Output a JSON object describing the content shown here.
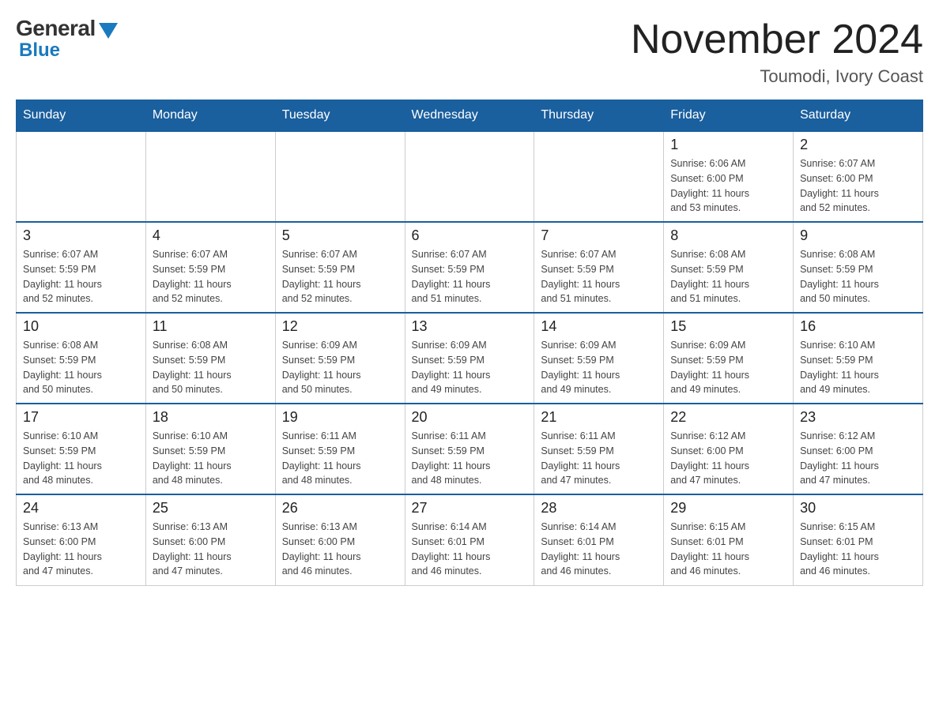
{
  "logo": {
    "general": "General",
    "blue": "Blue"
  },
  "title": "November 2024",
  "location": "Toumodi, Ivory Coast",
  "weekdays": [
    "Sunday",
    "Monday",
    "Tuesday",
    "Wednesday",
    "Thursday",
    "Friday",
    "Saturday"
  ],
  "weeks": [
    [
      {
        "day": "",
        "info": ""
      },
      {
        "day": "",
        "info": ""
      },
      {
        "day": "",
        "info": ""
      },
      {
        "day": "",
        "info": ""
      },
      {
        "day": "",
        "info": ""
      },
      {
        "day": "1",
        "info": "Sunrise: 6:06 AM\nSunset: 6:00 PM\nDaylight: 11 hours\nand 53 minutes."
      },
      {
        "day": "2",
        "info": "Sunrise: 6:07 AM\nSunset: 6:00 PM\nDaylight: 11 hours\nand 52 minutes."
      }
    ],
    [
      {
        "day": "3",
        "info": "Sunrise: 6:07 AM\nSunset: 5:59 PM\nDaylight: 11 hours\nand 52 minutes."
      },
      {
        "day": "4",
        "info": "Sunrise: 6:07 AM\nSunset: 5:59 PM\nDaylight: 11 hours\nand 52 minutes."
      },
      {
        "day": "5",
        "info": "Sunrise: 6:07 AM\nSunset: 5:59 PM\nDaylight: 11 hours\nand 52 minutes."
      },
      {
        "day": "6",
        "info": "Sunrise: 6:07 AM\nSunset: 5:59 PM\nDaylight: 11 hours\nand 51 minutes."
      },
      {
        "day": "7",
        "info": "Sunrise: 6:07 AM\nSunset: 5:59 PM\nDaylight: 11 hours\nand 51 minutes."
      },
      {
        "day": "8",
        "info": "Sunrise: 6:08 AM\nSunset: 5:59 PM\nDaylight: 11 hours\nand 51 minutes."
      },
      {
        "day": "9",
        "info": "Sunrise: 6:08 AM\nSunset: 5:59 PM\nDaylight: 11 hours\nand 50 minutes."
      }
    ],
    [
      {
        "day": "10",
        "info": "Sunrise: 6:08 AM\nSunset: 5:59 PM\nDaylight: 11 hours\nand 50 minutes."
      },
      {
        "day": "11",
        "info": "Sunrise: 6:08 AM\nSunset: 5:59 PM\nDaylight: 11 hours\nand 50 minutes."
      },
      {
        "day": "12",
        "info": "Sunrise: 6:09 AM\nSunset: 5:59 PM\nDaylight: 11 hours\nand 50 minutes."
      },
      {
        "day": "13",
        "info": "Sunrise: 6:09 AM\nSunset: 5:59 PM\nDaylight: 11 hours\nand 49 minutes."
      },
      {
        "day": "14",
        "info": "Sunrise: 6:09 AM\nSunset: 5:59 PM\nDaylight: 11 hours\nand 49 minutes."
      },
      {
        "day": "15",
        "info": "Sunrise: 6:09 AM\nSunset: 5:59 PM\nDaylight: 11 hours\nand 49 minutes."
      },
      {
        "day": "16",
        "info": "Sunrise: 6:10 AM\nSunset: 5:59 PM\nDaylight: 11 hours\nand 49 minutes."
      }
    ],
    [
      {
        "day": "17",
        "info": "Sunrise: 6:10 AM\nSunset: 5:59 PM\nDaylight: 11 hours\nand 48 minutes."
      },
      {
        "day": "18",
        "info": "Sunrise: 6:10 AM\nSunset: 5:59 PM\nDaylight: 11 hours\nand 48 minutes."
      },
      {
        "day": "19",
        "info": "Sunrise: 6:11 AM\nSunset: 5:59 PM\nDaylight: 11 hours\nand 48 minutes."
      },
      {
        "day": "20",
        "info": "Sunrise: 6:11 AM\nSunset: 5:59 PM\nDaylight: 11 hours\nand 48 minutes."
      },
      {
        "day": "21",
        "info": "Sunrise: 6:11 AM\nSunset: 5:59 PM\nDaylight: 11 hours\nand 47 minutes."
      },
      {
        "day": "22",
        "info": "Sunrise: 6:12 AM\nSunset: 6:00 PM\nDaylight: 11 hours\nand 47 minutes."
      },
      {
        "day": "23",
        "info": "Sunrise: 6:12 AM\nSunset: 6:00 PM\nDaylight: 11 hours\nand 47 minutes."
      }
    ],
    [
      {
        "day": "24",
        "info": "Sunrise: 6:13 AM\nSunset: 6:00 PM\nDaylight: 11 hours\nand 47 minutes."
      },
      {
        "day": "25",
        "info": "Sunrise: 6:13 AM\nSunset: 6:00 PM\nDaylight: 11 hours\nand 47 minutes."
      },
      {
        "day": "26",
        "info": "Sunrise: 6:13 AM\nSunset: 6:00 PM\nDaylight: 11 hours\nand 46 minutes."
      },
      {
        "day": "27",
        "info": "Sunrise: 6:14 AM\nSunset: 6:01 PM\nDaylight: 11 hours\nand 46 minutes."
      },
      {
        "day": "28",
        "info": "Sunrise: 6:14 AM\nSunset: 6:01 PM\nDaylight: 11 hours\nand 46 minutes."
      },
      {
        "day": "29",
        "info": "Sunrise: 6:15 AM\nSunset: 6:01 PM\nDaylight: 11 hours\nand 46 minutes."
      },
      {
        "day": "30",
        "info": "Sunrise: 6:15 AM\nSunset: 6:01 PM\nDaylight: 11 hours\nand 46 minutes."
      }
    ]
  ]
}
